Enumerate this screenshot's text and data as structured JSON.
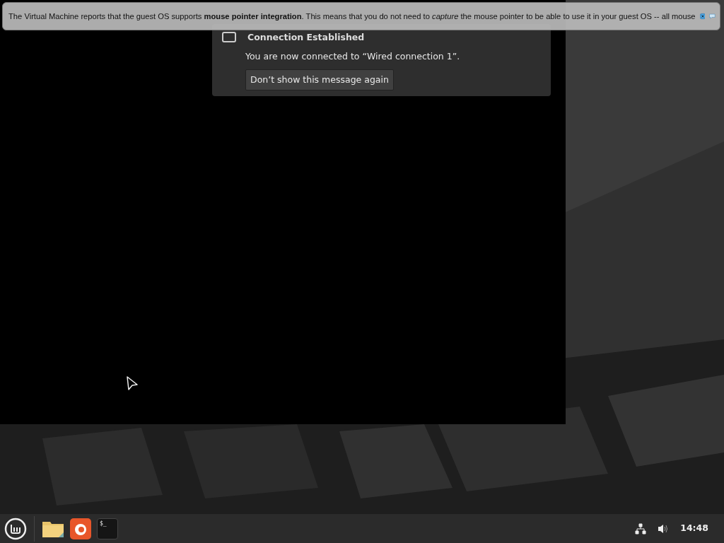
{
  "vm_notice": {
    "text": "The Virtual Machine reports that the guest OS supports **mouse pointer integration**. This means that you do not need to *capture* the mouse pointer to be able to use it in your guest OS -- all mouse"
  },
  "notification": {
    "title": "Connection Established",
    "message": "You are now connected to “Wired connection 1”.",
    "button": "Don’t show this message again"
  },
  "taskbar": {
    "launchers": [
      {
        "kind": "files"
      },
      {
        "kind": "browser"
      },
      {
        "kind": "terminal",
        "glyph": "$_"
      }
    ],
    "clock": "14:48"
  }
}
